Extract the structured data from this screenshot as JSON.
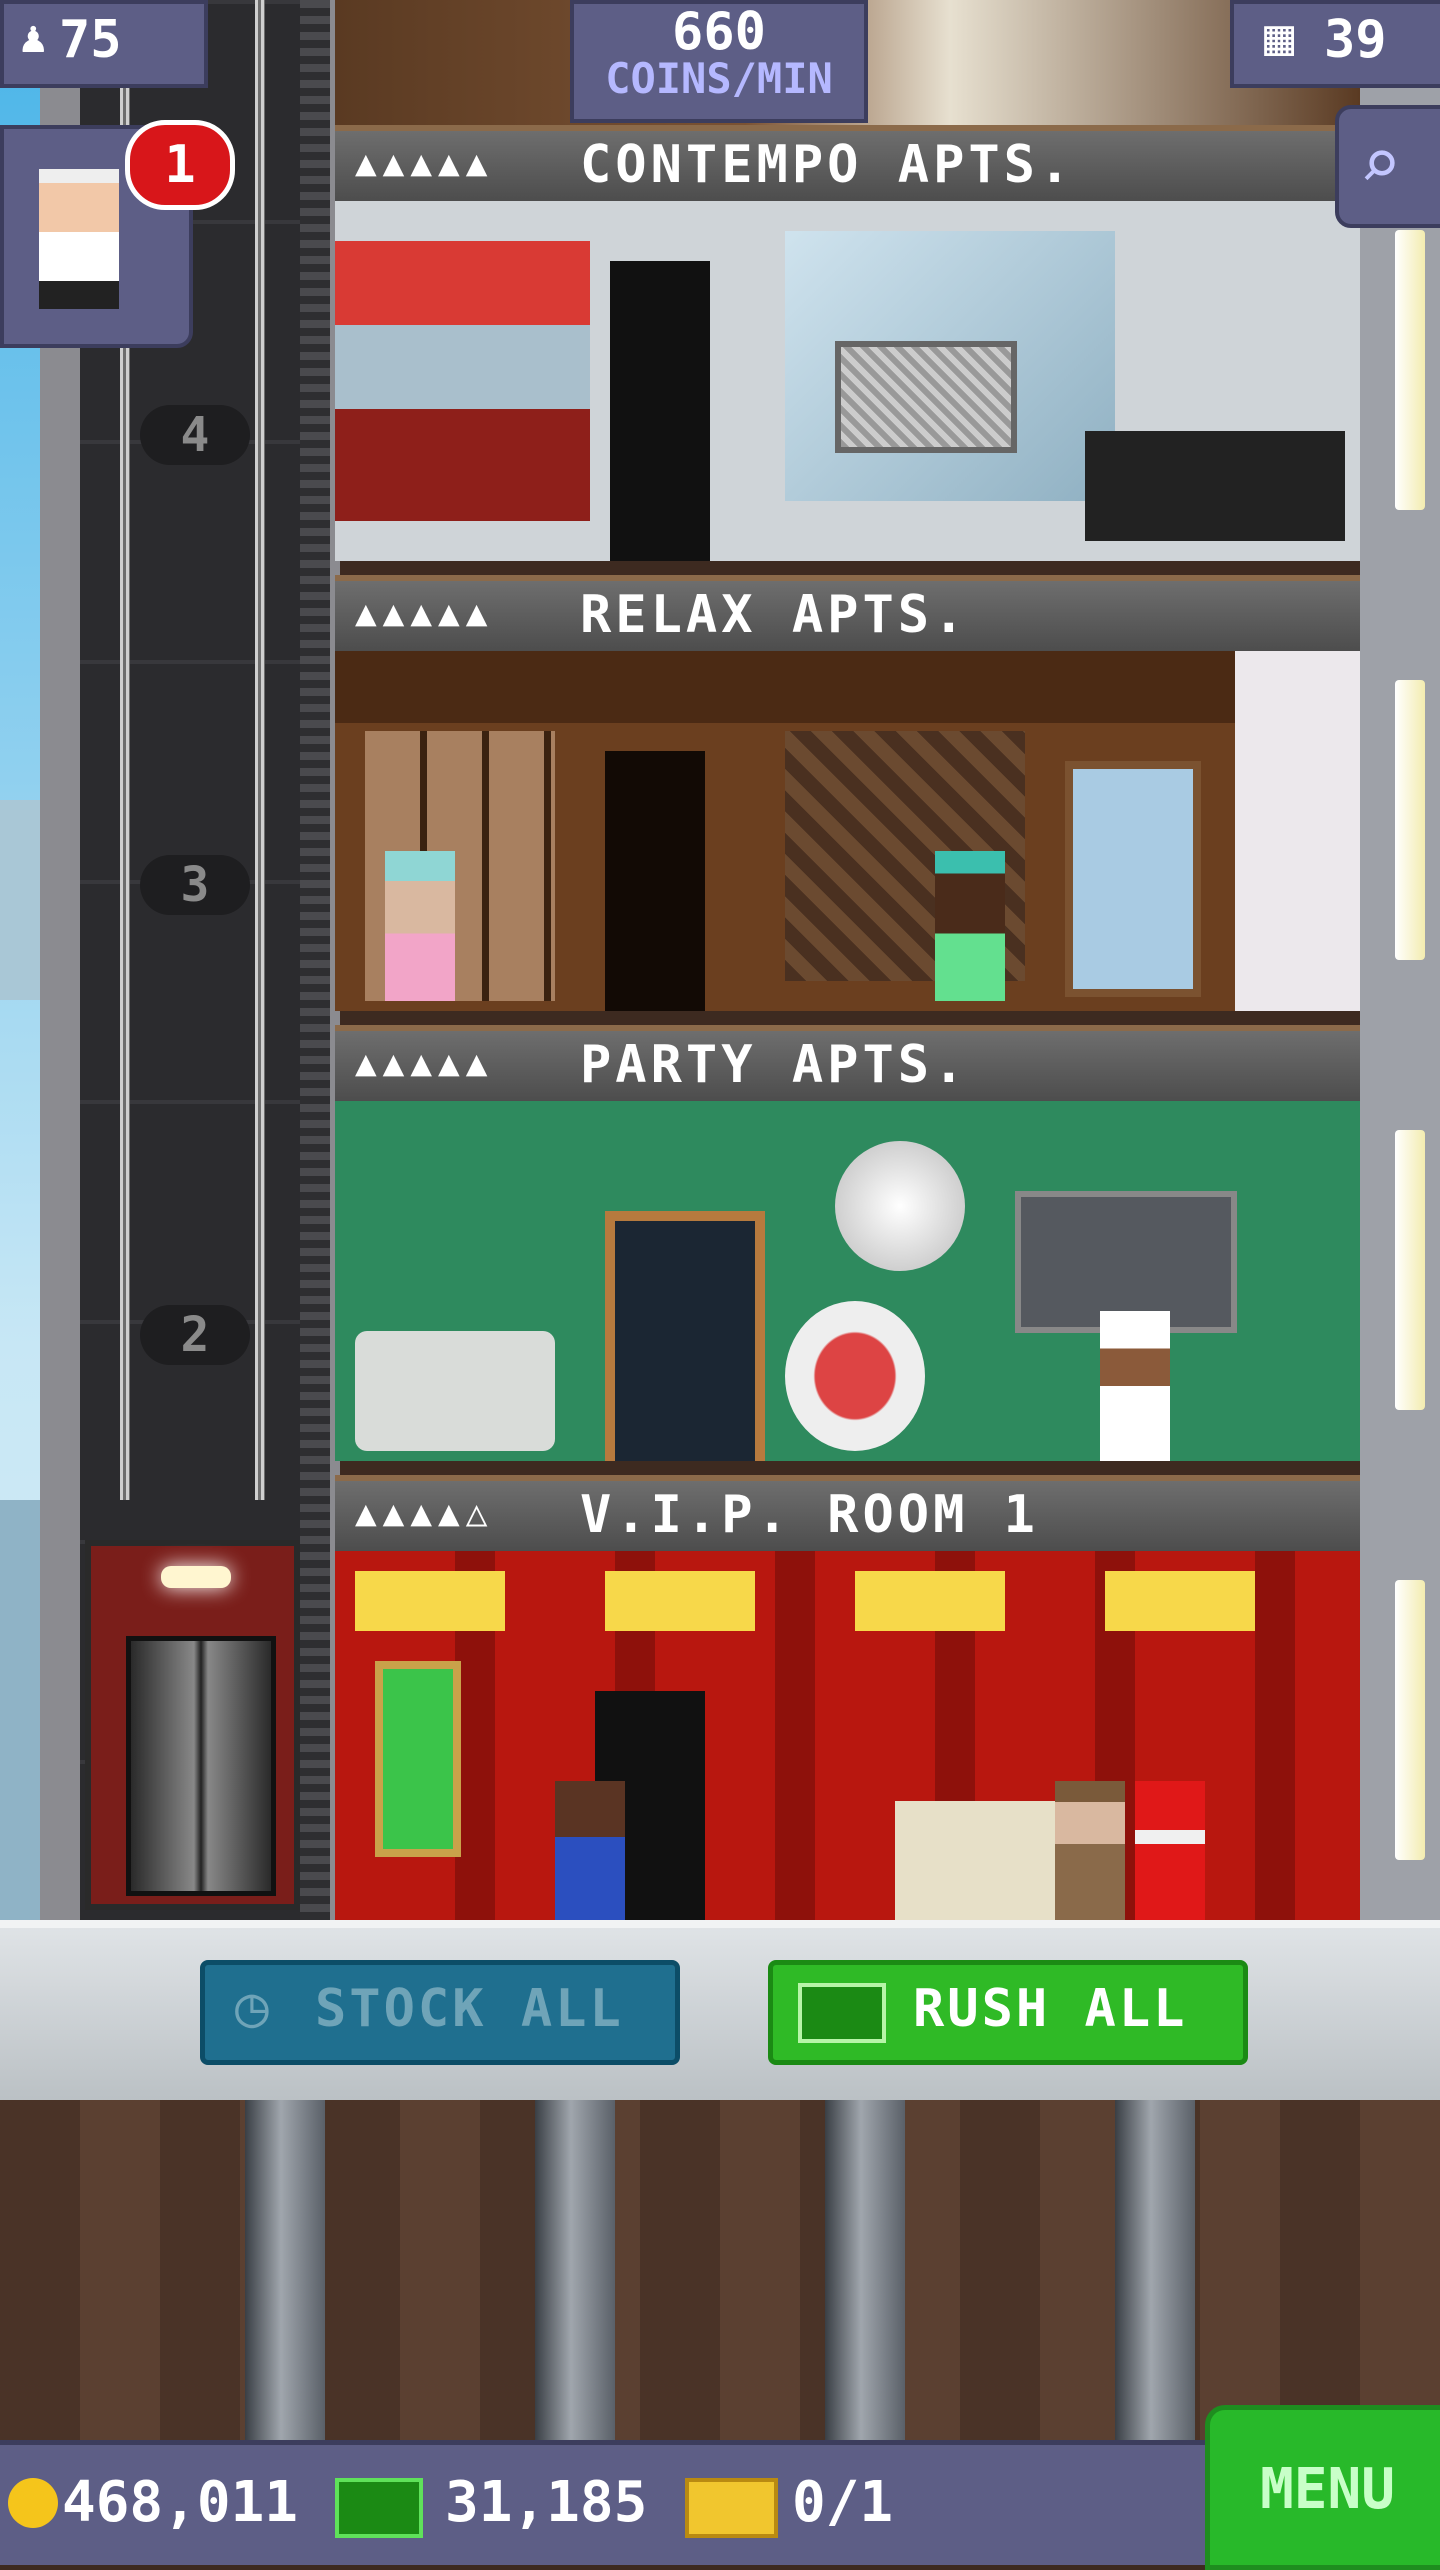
{
  "top_hud": {
    "population": "75",
    "coins_per_min_value": "660",
    "coins_per_min_unit": "COINS/MIN",
    "floor_count": "39"
  },
  "notification_badge": "1",
  "floors": [
    {
      "name": "CONTEMPO APTS.",
      "stars": "▲▲▲▲▲"
    },
    {
      "name": "RELAX APTS.",
      "stars": "▲▲▲▲▲"
    },
    {
      "name": "PARTY APTS.",
      "stars": "▲▲▲▲▲"
    },
    {
      "name": "V.I.P. ROOM 1",
      "stars": "▲▲▲▲△"
    }
  ],
  "elevator_floor_numbers": [
    "4",
    "3",
    "2"
  ],
  "actions": {
    "stock_all": "STOCK ALL",
    "rush_all": "RUSH ALL"
  },
  "bottom_hud": {
    "coins": "468,011",
    "bux": "31,185",
    "tickets": "0/1",
    "menu": "MENU"
  },
  "colors": {
    "hud": "#5d5e86",
    "stock_button": "#1f6f8f",
    "rush_button": "#2fba26",
    "menu_button": "#28b92a",
    "badge": "#d8161a"
  }
}
